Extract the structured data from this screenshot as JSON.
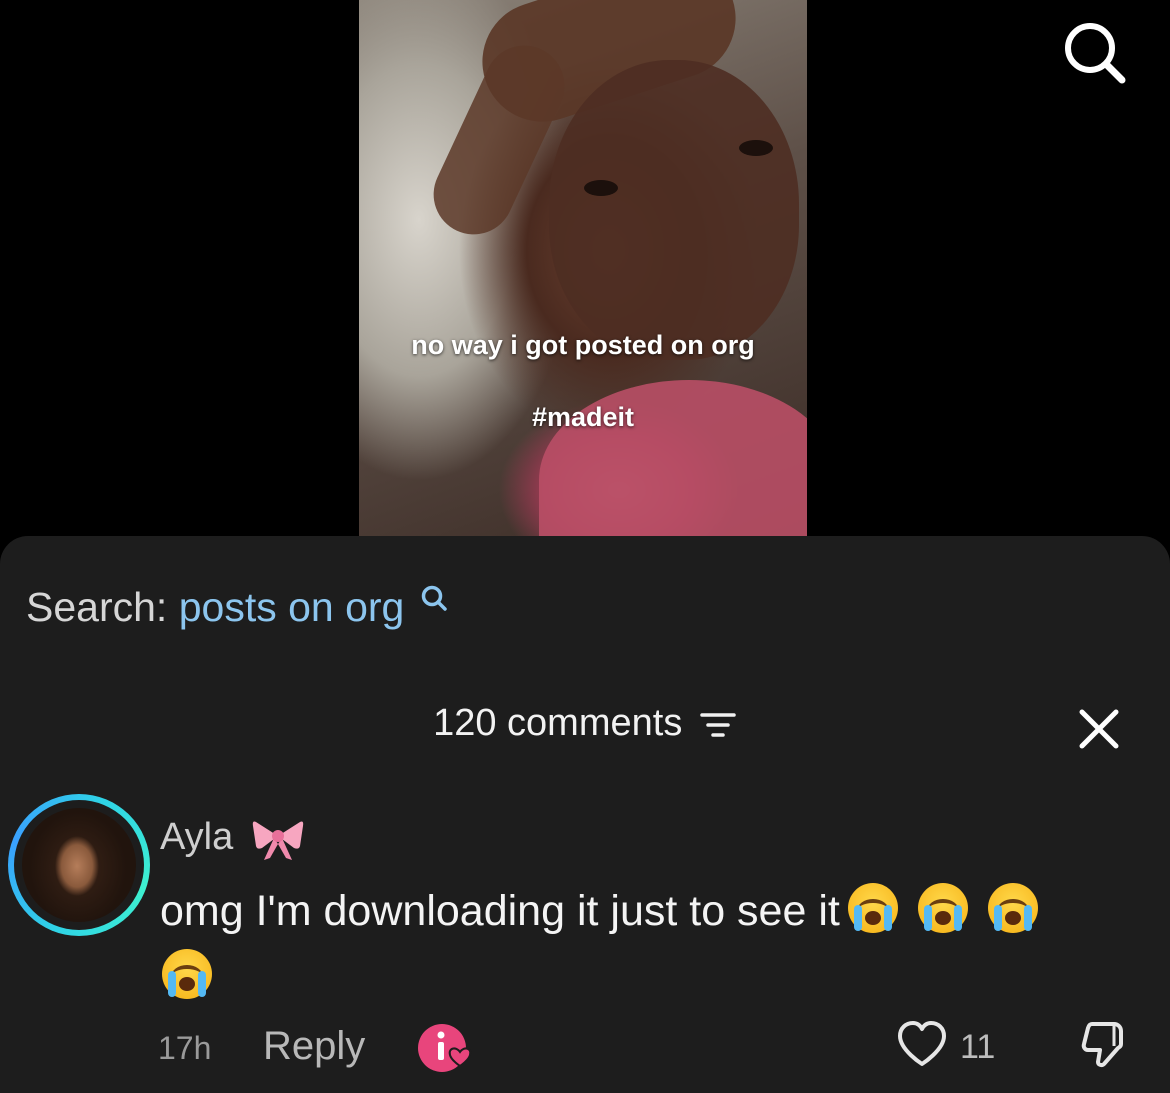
{
  "video": {
    "caption_line1": "no way i got posted on org",
    "caption_line2": "#madeit"
  },
  "search": {
    "label": "Search:",
    "term": "posts on org"
  },
  "comments": {
    "header": "120 comments"
  },
  "comment": {
    "author": "Ayla",
    "text": "omg I'm downloading it just to see it",
    "emoji_count": 4,
    "time": "17h",
    "reply_label": "Reply",
    "like_count": "11"
  },
  "icons": {
    "top_search": "search-icon",
    "search_suggestion": "search-icon",
    "filter": "filter-icon",
    "close": "close-icon",
    "bow": "ribbon-bow-icon",
    "emoji": "loudly-crying-face-icon",
    "creator_badge": "creator-liked-icon",
    "like": "heart-icon",
    "dislike": "thumbs-down-icon"
  },
  "colors": {
    "sheet_background": "#1d1d1d",
    "search_term": "#8cc5ee",
    "avatar_ring": "#2fd3e6",
    "creator_badge": "#e8457c"
  }
}
